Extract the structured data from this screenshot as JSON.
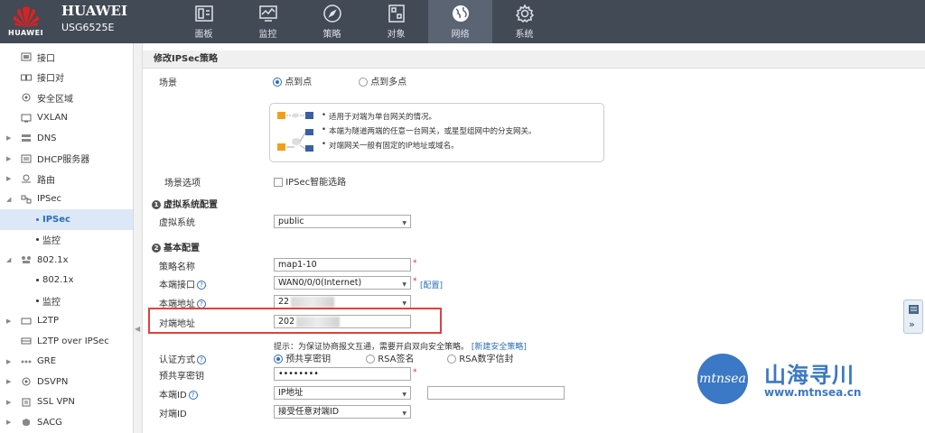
{
  "header": {
    "logo_text": "HUAWEI",
    "brand": "HUAWEI",
    "model": "USG6525E",
    "nav": [
      {
        "label": "面板",
        "icon": "dashboard-icon"
      },
      {
        "label": "监控",
        "icon": "monitor-icon"
      },
      {
        "label": "策略",
        "icon": "compass-icon"
      },
      {
        "label": "对象",
        "icon": "object-icon"
      },
      {
        "label": "网络",
        "icon": "globe-icon",
        "active": true
      },
      {
        "label": "系统",
        "icon": "gear-icon"
      }
    ]
  },
  "sidebar": {
    "items": [
      {
        "label": "接口",
        "icon": "interface-icon"
      },
      {
        "label": "接口对",
        "icon": "interface-pair-icon"
      },
      {
        "label": "安全区域",
        "icon": "security-zone-icon"
      },
      {
        "label": "VXLAN",
        "icon": "vxlan-icon"
      },
      {
        "label": "DNS",
        "icon": "dns-icon"
      },
      {
        "label": "DHCP服务器",
        "icon": "dhcp-icon"
      },
      {
        "label": "路由",
        "icon": "route-icon"
      },
      {
        "label": "IPSec",
        "icon": "ipsec-icon"
      },
      {
        "label": "IPSec",
        "active": true
      },
      {
        "label": "监控"
      },
      {
        "label": "802.1x",
        "icon": "dot1x-icon"
      },
      {
        "label": "802.1x"
      },
      {
        "label": "监控"
      },
      {
        "label": "L2TP",
        "icon": "l2tp-icon"
      },
      {
        "label": "L2TP over IPSec",
        "icon": "l2tp-ipsec-icon"
      },
      {
        "label": "GRE",
        "icon": "gre-icon"
      },
      {
        "label": "DSVPN",
        "icon": "dsvpn-icon"
      },
      {
        "label": "SSL VPN",
        "icon": "sslvpn-icon"
      },
      {
        "label": "SACG",
        "icon": "sacg-icon"
      }
    ]
  },
  "form": {
    "title": "修改IPSec策略",
    "scenario_label": "场景",
    "scenario_options": [
      "点到点",
      "点到多点"
    ],
    "scenario_selected": "点到点",
    "scenario_notes": [
      "适用于对端为单台网关的情况。",
      "本端为隧道两端的任意一台网关，或星型组网中的分支网关。",
      "对端网关一般有固定的IP地址或域名。"
    ],
    "scenario_option_label": "场景选项",
    "smart_route_label": "IPSec智能选路",
    "section1": {
      "num": "1",
      "title": "虚拟系统配置"
    },
    "vsys_label": "虚拟系统",
    "vsys_value": "public",
    "section2": {
      "num": "2",
      "title": "基本配置"
    },
    "policy_name_label": "策略名称",
    "policy_name_value": "map1-10",
    "local_if_label": "本端接口",
    "local_if_value": "WAN0/0/0(Internet)",
    "config_link": "[配置]",
    "local_addr_label": "本端地址",
    "local_addr_value": "22",
    "peer_addr_label": "对端地址",
    "peer_addr_value": "202",
    "hint_text": "提示：为保证协商报文互通，需要开启双向安全策略。",
    "new_policy_link": "[新建安全策略]",
    "auth_label": "认证方式",
    "auth_options": [
      "预共享密钥",
      "RSA签名",
      "RSA数字信封"
    ],
    "auth_selected": "预共享密钥",
    "psk_label": "预共享密钥",
    "psk_value": "••••••••",
    "local_id_label": "本端ID",
    "local_id_value": "IP地址",
    "local_id_extra": "",
    "peer_id_label": "对端ID",
    "peer_id_value": "接受任意对端ID",
    "required_mark": "*",
    "help_mark": "?"
  },
  "watermark": {
    "logo_text": "mtnsea",
    "cn": "山海寻川",
    "url": "www.mtnsea.cn"
  },
  "colors": {
    "topbar": "#424a55",
    "accent": "#2a6ebb",
    "highlight": "#e04040",
    "watermark": "#3b78c5"
  }
}
